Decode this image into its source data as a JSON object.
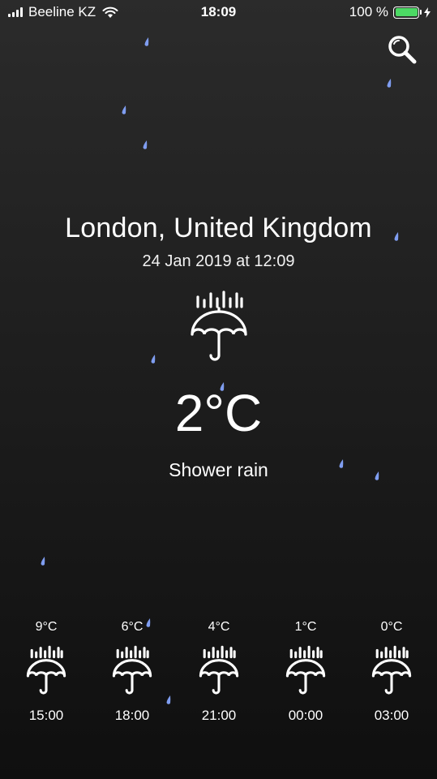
{
  "status_bar": {
    "carrier": "Beeline KZ",
    "time": "18:09",
    "battery": "100 %"
  },
  "header": {
    "search_icon": "search-icon"
  },
  "current": {
    "location": "London, United Kingdom",
    "datetime": "24 Jan 2019 at 12:09",
    "icon": "umbrella-rain-icon",
    "temperature": "2°C",
    "condition": "Shower rain"
  },
  "forecast": [
    {
      "temp": "9°C",
      "time": "15:00",
      "icon": "umbrella-rain-icon"
    },
    {
      "temp": "6°C",
      "time": "18:00",
      "icon": "umbrella-rain-icon"
    },
    {
      "temp": "4°C",
      "time": "21:00",
      "icon": "umbrella-rain-icon"
    },
    {
      "temp": "1°C",
      "time": "00:00",
      "icon": "umbrella-rain-icon"
    },
    {
      "temp": "0°C",
      "time": "03:00",
      "icon": "umbrella-rain-icon"
    }
  ],
  "colors": {
    "background_top": "#2b2b2b",
    "background_bottom": "#0f0f0f",
    "text": "#ffffff",
    "rain_drop": "#7f9df0",
    "battery": "#4cd964"
  }
}
